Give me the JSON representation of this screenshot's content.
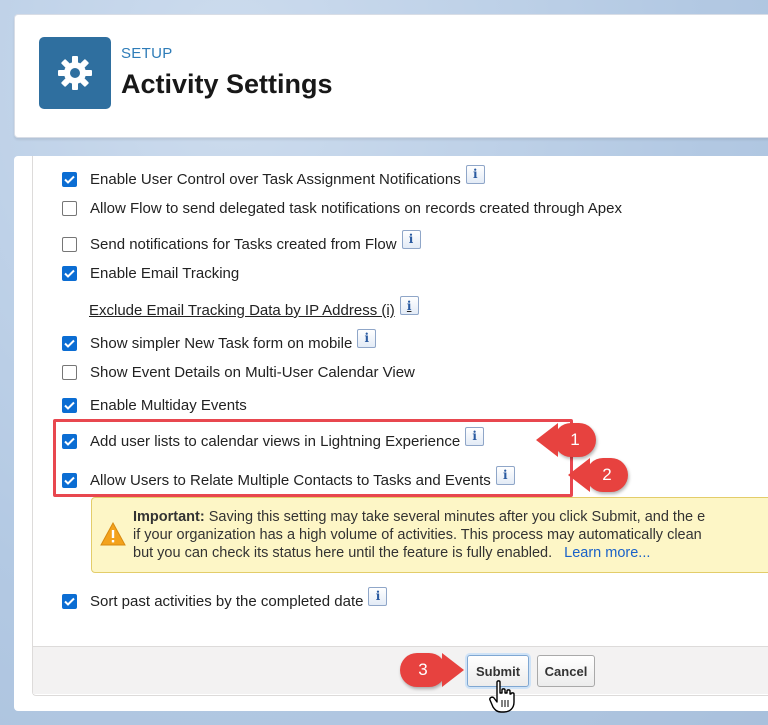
{
  "header": {
    "eyebrow": "SETUP",
    "title": "Activity Settings",
    "icon": "gear-icon"
  },
  "settings": [
    {
      "label": "Enable User Control over Task Assignment Notifications",
      "checked": true,
      "info": true
    },
    {
      "label": "Allow Flow to send delegated task notifications on records created through Apex",
      "checked": false,
      "info": false
    },
    {
      "label": "Send notifications for Tasks created from Flow",
      "checked": false,
      "info": true
    },
    {
      "label": "Enable Email Tracking",
      "checked": true,
      "info": false
    },
    {
      "label": "Show simpler New Task form on mobile",
      "checked": true,
      "info": true
    },
    {
      "label": "Show Event Details on Multi-User Calendar View",
      "checked": false,
      "info": false
    },
    {
      "label": "Enable Multiday Events",
      "checked": true,
      "info": false
    },
    {
      "label": "Add user lists to calendar views in Lightning Experience",
      "checked": true,
      "info": true
    },
    {
      "label": "Allow Users to Relate Multiple Contacts to Tasks and Events",
      "checked": true,
      "info": true
    },
    {
      "label": "Sort past activities by the completed date",
      "checked": true,
      "info": true
    }
  ],
  "email_tracking_link": "Exclude Email Tracking Data by IP Address (i)",
  "info_glyph": "i",
  "warning": {
    "title": "Important:",
    "line1": "Saving this setting may take several minutes after you click Submit, and the e",
    "line2": "if your organization has a high volume of activities. This process may automatically clean",
    "line3": "but you can check its status here until the feature is fully enabled.",
    "link": "Learn more..."
  },
  "callouts": [
    "1",
    "2",
    "3"
  ],
  "buttons": {
    "submit": "Submit",
    "cancel": "Cancel"
  },
  "colors": {
    "accent": "#0b6dd3",
    "callout": "#e7423f",
    "setup_icon_bg": "#2f6f9f",
    "warning_bg": "#fdf6c6"
  }
}
